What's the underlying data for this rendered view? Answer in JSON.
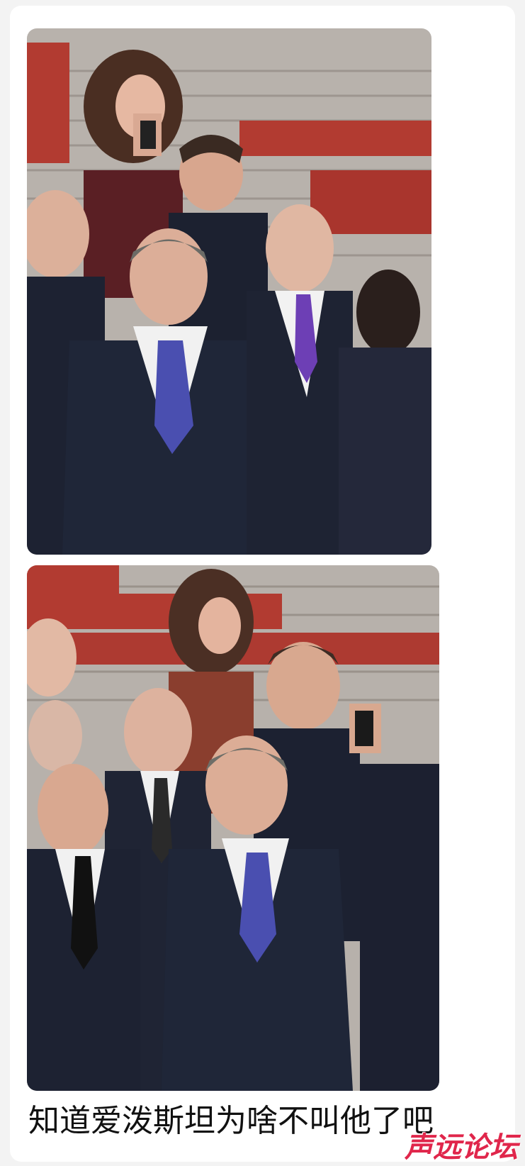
{
  "post": {
    "caption": "知道爱泼斯坦为啥不叫他了吧"
  },
  "watermark": {
    "text": "声远论坛",
    "color": "#e0264b"
  },
  "photos": [
    {
      "label": "photo-1"
    },
    {
      "label": "photo-2"
    }
  ],
  "colors": {
    "stairs": "#b9b3ad",
    "red_steps": "#b03a32",
    "suit": "#1f2535",
    "tie": "#4a4fb0"
  }
}
